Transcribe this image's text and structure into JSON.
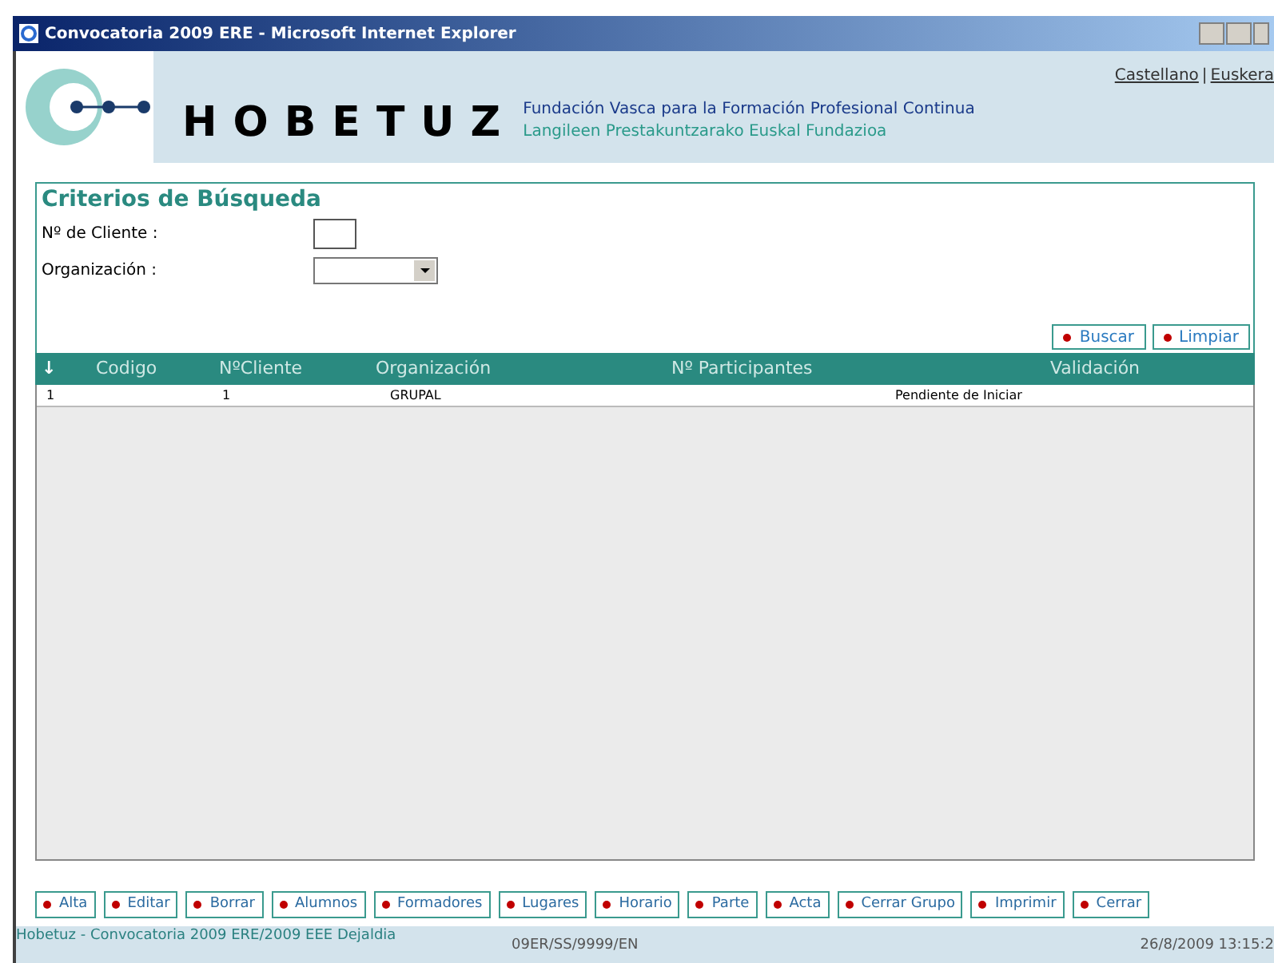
{
  "window": {
    "title": "Convocatoria 2009 ERE - Microsoft Internet Explorer"
  },
  "languages": [
    "Castellano",
    "Euskera"
  ],
  "language_separator": "|",
  "brand": {
    "name": "HOBETUZ",
    "tagline_es": "Fundación Vasca para la Formación Profesional Continua",
    "tagline_eu": "Langileen Prestakuntzarako Euskal Fundazioa"
  },
  "search": {
    "title": "Criterios de Búsqueda",
    "fields": [
      {
        "label": "Nº de Cliente :",
        "kind": "text"
      },
      {
        "label": "Organización :",
        "kind": "select"
      }
    ],
    "buttons": [
      "Buscar",
      "Limpiar"
    ]
  },
  "table": {
    "sort_glyph": "↓",
    "columns": [
      "Codigo",
      "NºCliente",
      "Organización",
      "Nº Participantes",
      "Validación"
    ],
    "rows": [
      [
        "1",
        "1",
        "GRUPAL",
        "",
        "Pendiente de Iniciar"
      ]
    ]
  },
  "actions": [
    "Alta",
    "Editar",
    "Borrar",
    "Alumnos",
    "Formadores",
    "Lugares",
    "Horario",
    "Parte",
    "Acta",
    "Cerrar Grupo",
    "Imprimir",
    "Cerrar"
  ],
  "status_bar": {
    "left": "Hobetuz - Convocatoria 2009 ERE/2009 EEE Dejaldia",
    "center": "09ER/SS/9999/EN",
    "right": "26/8/2009 13:15:2"
  }
}
